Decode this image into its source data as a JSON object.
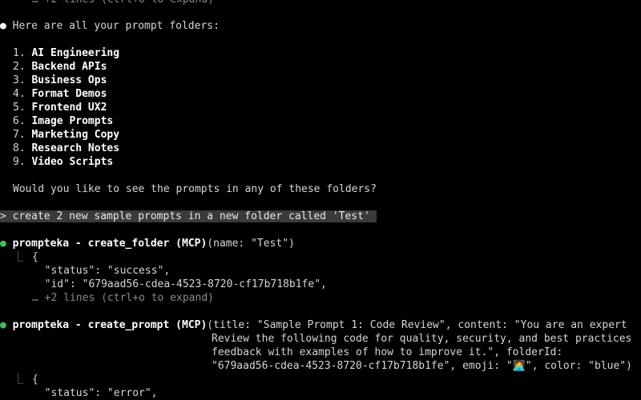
{
  "top_truncated": "… +2 lines (ctrl+o to expand)",
  "assistant_msg": {
    "bullet": "●",
    "intro": "Here are all your prompt folders:",
    "folders": [
      {
        "num": "1.",
        "name": "AI Engineering"
      },
      {
        "num": "2.",
        "name": "Backend APIs"
      },
      {
        "num": "3.",
        "name": "Business Ops"
      },
      {
        "num": "4.",
        "name": "Format Demos"
      },
      {
        "num": "5.",
        "name": "Frontend UX2"
      },
      {
        "num": "6.",
        "name": "Image Prompts"
      },
      {
        "num": "7.",
        "name": "Marketing Copy"
      },
      {
        "num": "8.",
        "name": "Research Notes"
      },
      {
        "num": "9.",
        "name": "Video Scripts"
      }
    ],
    "question": "Would you like to see the prompts in any of these folders?"
  },
  "user_prompt": {
    "marker": ">",
    "text": "create 2 new sample prompts in a new folder called 'Test'"
  },
  "tool_call_1": {
    "bullet": "●",
    "name": "prompteka - create_folder (MCP)",
    "args": "(name: \"Test\")",
    "result_branch": "⎿",
    "result_lines": [
      "{",
      "  \"status\": \"success\",",
      "  \"id\": \"679aad56-cdea-4523-8720-cf17b718b1fe\","
    ],
    "truncated": "… +2 lines (ctrl+o to expand)"
  },
  "tool_call_2": {
    "bullet": "●",
    "name": "prompteka - create_prompt (MCP)",
    "args_lines": [
      "(title: \"Sample Prompt 1: Code Review\", content: \"You are an expert",
      "Review the following code for quality, security, and best practices",
      "feedback with examples of how to improve it.\", folderId:",
      "\"679aad56-cdea-4523-8720-cf17b718b1fe\", emoji: \"🧑‍💻\", color: \"blue\")"
    ],
    "result_branch": "⎿",
    "result_lines": [
      "{",
      "  \"status\": \"error\","
    ]
  }
}
